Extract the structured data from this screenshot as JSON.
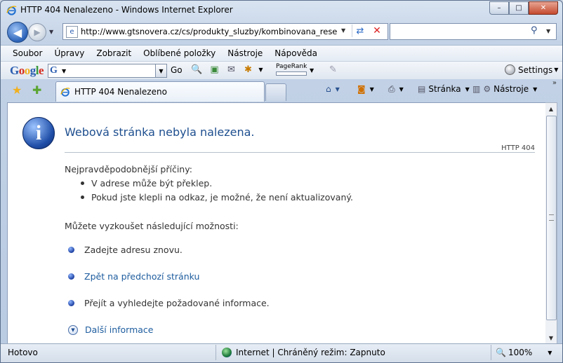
{
  "window": {
    "title": "HTTP 404 Nenalezeno - Windows Internet Explorer",
    "controls": {
      "minimize": "–",
      "maximize": "□",
      "close": "✕"
    }
  },
  "nav": {
    "back_glyph": "◀",
    "forward_glyph": "▶",
    "address": "http://www.gtsnovera.cz/cs/produkty_sluzby/kombinovana_reseni/%",
    "search_value": "",
    "search_placeholder": ""
  },
  "menu": {
    "items": [
      "Soubor",
      "Úpravy",
      "Zobrazit",
      "Oblíbené položky",
      "Nástroje",
      "Nápověda"
    ]
  },
  "google_toolbar": {
    "logo": "Google",
    "go_label": "Go",
    "pagerank_label": "PageRank",
    "settings_label": "Settings"
  },
  "tabs": {
    "active_label": "HTTP 404 Nenalezeno"
  },
  "commands": {
    "page_label": "Stránka",
    "tools_label": "Nástroje"
  },
  "content": {
    "title": "Webová stránka nebyla nalezena.",
    "http_code": "HTTP 404",
    "causes_heading": "Nejpravděpodobnější příčiny:",
    "causes": [
      "V adrese může být překlep.",
      "Pokud jste klepli na odkaz, je možné, že není aktualizovaný."
    ],
    "options_heading": "Můžete vyzkoušet následující možnosti:",
    "options": [
      "Zadejte adresu znovu.",
      "Zpět na předchozí stránku",
      "Přejít  a vyhledejte požadované informace."
    ],
    "more_info": "Další informace"
  },
  "status": {
    "text": "Hotovo",
    "zone": "Internet | Chráněný režim: Zapnuto",
    "zoom": "100%"
  },
  "colors": {
    "link": "#1d5c9e",
    "title": "#1e4f8f",
    "chrome": "#c3d2e6"
  }
}
